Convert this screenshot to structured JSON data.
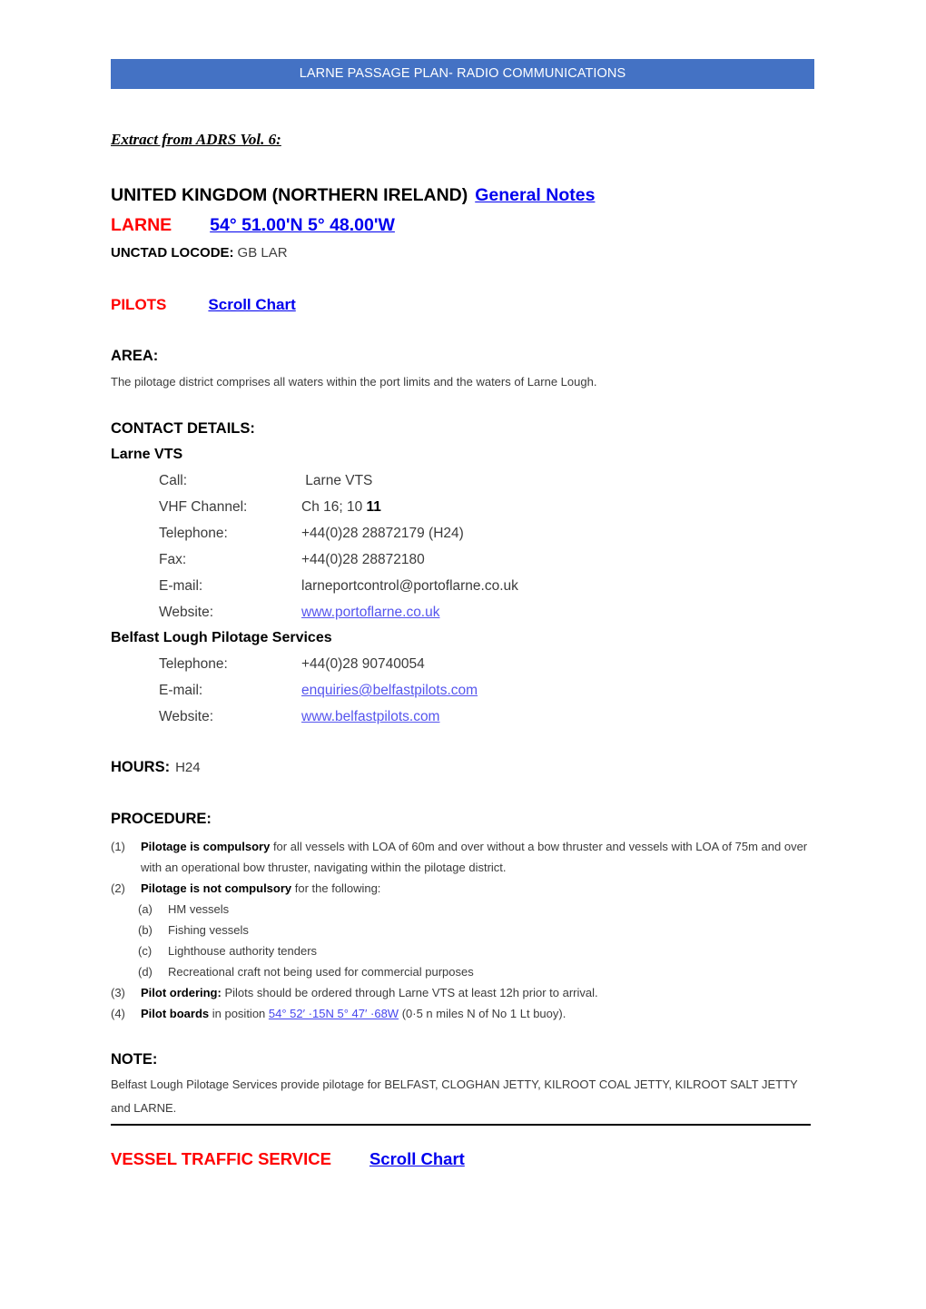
{
  "banner": {
    "title": "LARNE PASSAGE PLAN- RADIO COMMUNICATIONS",
    "background_color": "#4472C4",
    "text_color": "#FFFFFF"
  },
  "colors": {
    "accent_red": "#FF0000",
    "link_blue": "#0000EE",
    "soft_link_blue": "#5555EE",
    "banner_blue": "#4472C4"
  },
  "extract_note": "Extract from ADRS Vol. 6:",
  "title": {
    "country": "UNITED KINGDOM (NORTHERN IRELAND)",
    "general_notes_link": "General Notes",
    "port": "LARNE",
    "coordinates": "54° 51.00'N 5° 48.00'W",
    "locode_label": "UNCTAD LOCODE:",
    "locode_value": "GB LAR"
  },
  "pilots": {
    "heading": "PILOTS",
    "scroll_chart_link": "Scroll Chart"
  },
  "area": {
    "heading": "AREA:",
    "text": "The pilotage district comprises all waters within the port limits and the waters of Larne Lough."
  },
  "contact_details": {
    "heading": "CONTACT DETAILS:",
    "groups": [
      {
        "name": "Larne VTS",
        "rows": [
          {
            "label": "Call:",
            "value": " Larne VTS",
            "type": "text"
          },
          {
            "label": "VHF Channel:",
            "value": "Ch 16; 10 ",
            "bold_suffix": "11",
            "type": "text"
          },
          {
            "label": "Telephone:",
            "value": "+44(0)28 28872179 (H24)",
            "type": "text"
          },
          {
            "label": "Fax:",
            "value": "+44(0)28 28872180",
            "type": "text"
          },
          {
            "label": "E-mail:",
            "value": "larneportcontrol@portoflarne.co.uk",
            "type": "text"
          },
          {
            "label": "Website:",
            "value": "www.portoflarne.co.uk",
            "type": "link"
          }
        ]
      },
      {
        "name": "Belfast Lough Pilotage Services",
        "rows": [
          {
            "label": "Telephone:",
            "value": "+44(0)28 90740054",
            "type": "text"
          },
          {
            "label": "E-mail:",
            "value": "enquiries@belfastpilots.com",
            "type": "link"
          },
          {
            "label": "Website:",
            "value": "www.belfastpilots.com",
            "type": "link"
          }
        ]
      }
    ]
  },
  "hours": {
    "label": "HOURS:",
    "value": "H24"
  },
  "procedure": {
    "heading": "PROCEDURE:",
    "items": [
      {
        "num": "(1)",
        "bold": "Pilotage is compulsory",
        "text": " for all vessels with LOA of 60m and over without a bow thruster and vessels with LOA of 75m and over with an operational bow thruster, navigating within the pilotage district."
      },
      {
        "num": "(2)",
        "bold": "Pilotage is not compulsory",
        "text": " for the following:"
      }
    ],
    "sub_items": [
      {
        "num": "(a)",
        "text": "HM vessels"
      },
      {
        "num": "(b)",
        "text": "Fishing vessels"
      },
      {
        "num": "(c)",
        "text": "Lighthouse authority tenders"
      },
      {
        "num": "(d)",
        "text": "Recreational craft not being used for commercial purposes"
      }
    ],
    "items_tail": [
      {
        "num": "(3)",
        "bold": "Pilot ordering:",
        "text": " Pilots should be ordered through Larne VTS at least 12h prior to arrival."
      }
    ],
    "item4": {
      "num": "(4)",
      "bold": "Pilot boards",
      "text_before": " in position ",
      "coord_link": "54° 52′ ·15N 5° 47′ ·68W",
      "text_after": " (0·5 n miles N of No 1 Lt buoy)."
    }
  },
  "note": {
    "heading": "NOTE:",
    "text": "Belfast Lough Pilotage Services provide pilotage for BELFAST, CLOGHAN JETTY, KILROOT COAL JETTY, KILROOT SALT JETTY and LARNE."
  },
  "vessel_traffic_service": {
    "heading": "VESSEL TRAFFIC SERVICE",
    "scroll_chart_link": "Scroll Chart"
  }
}
